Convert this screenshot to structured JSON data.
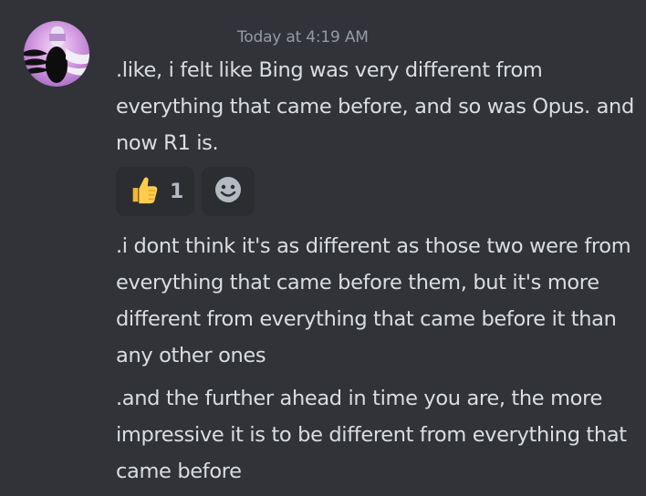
{
  "message": {
    "timestamp": "Today at 4:19 AM",
    "avatar_icon": "user-avatar",
    "paragraphs": [
      ".like, i felt like Bing was very different from everything that came before, and so was Opus. and now R1 is.",
      ".i dont think it's as different as those two were from everything that came before them, but it's more different from everything that came before it than any other ones",
      ".and the further ahead in time you are, the more impressive it is to be different from everything that came before"
    ],
    "reactions": [
      {
        "emoji": "thumbs-up-icon",
        "count": "1"
      }
    ],
    "add_reaction_icon": "add-reaction-smiley-icon"
  },
  "colors": {
    "background": "#313338",
    "text": "#dbdee1",
    "timestamp": "#949ba4",
    "reaction_bg": "#2b2d31"
  }
}
